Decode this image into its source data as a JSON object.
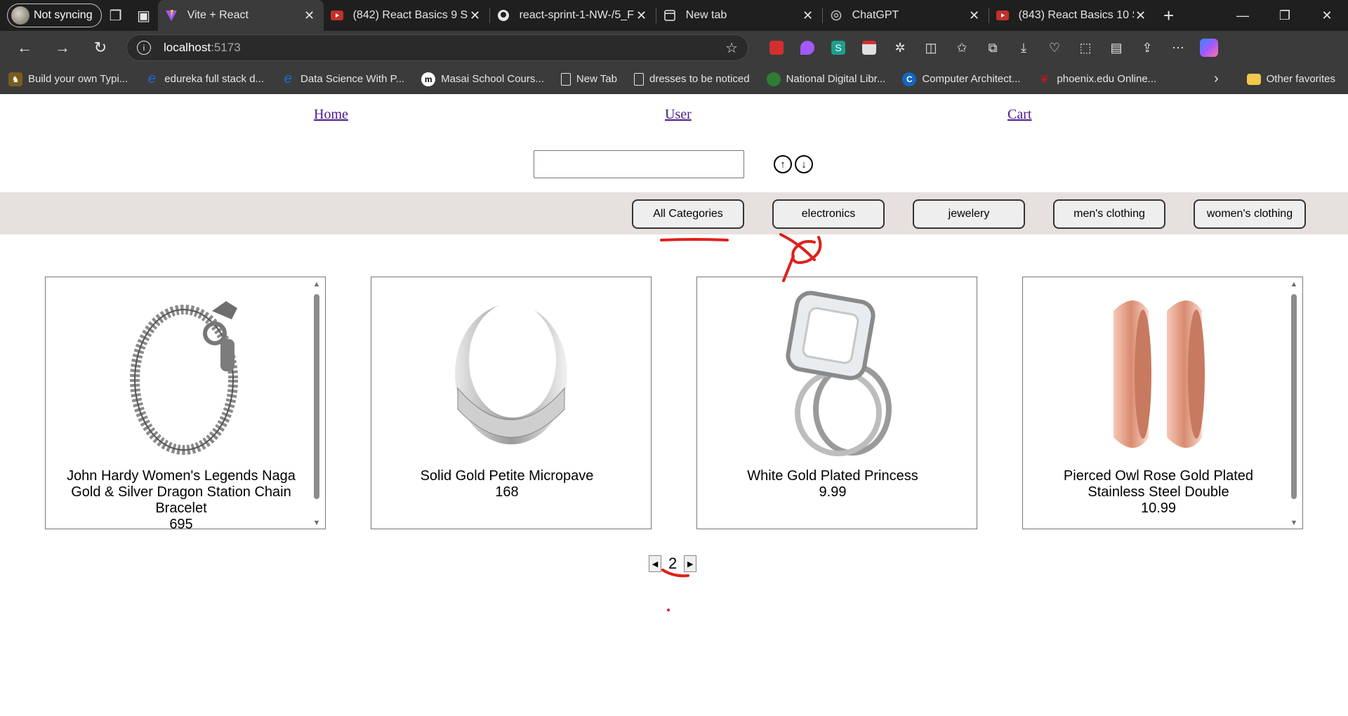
{
  "browser": {
    "profile_label": "Not syncing",
    "tabs": [
      {
        "title": "Vite + React",
        "favicon_color": "#a259ff",
        "active": true
      },
      {
        "title": "(842) React Basics 9 Spr",
        "favicon_color": "#ff0000",
        "active": false
      },
      {
        "title": "react-sprint-1-NW-/5_F",
        "favicon_color": "#ffffff",
        "active": false
      },
      {
        "title": "New tab",
        "favicon_color": "#cccccc",
        "active": false
      },
      {
        "title": "ChatGPT",
        "favicon_color": "#cccccc",
        "active": false
      },
      {
        "title": "(843) React Basics 10 Sp",
        "favicon_color": "#ff0000",
        "active": false
      }
    ],
    "url_host": "localhost",
    "url_port": ":5173",
    "bookmarks": [
      {
        "label": "Build your own Typi...",
        "color": "#7a5c1e"
      },
      {
        "label": "edureka full stack d...",
        "color": "#1a6fd1"
      },
      {
        "label": "Data Science With P...",
        "color": "#1a6fd1"
      },
      {
        "label": "Masai School Cours...",
        "color": "#ffffff"
      },
      {
        "label": "New Tab",
        "color": "#3b3b3b"
      },
      {
        "label": "dresses to be noticed",
        "color": "#3b3b3b"
      },
      {
        "label": "National Digital Libr...",
        "color": "#2e7d32"
      },
      {
        "label": "Computer Architect...",
        "color": "#1565c0"
      },
      {
        "label": "phoenix.edu Online...",
        "color": "#b71c1c"
      }
    ],
    "other_favorites": "Other favorites"
  },
  "nav": {
    "home": "Home",
    "user": "User",
    "cart": "Cart"
  },
  "search": {
    "value": "",
    "sort_up": "↑",
    "sort_down": "↓"
  },
  "categories": [
    "All Categories",
    "electronics",
    "jewelery",
    "men's clothing",
    "women's clothing"
  ],
  "products": [
    {
      "title": "John Hardy Women's Legends Naga Gold & Silver Dragon Station Chain Bracelet",
      "price": "695",
      "image": "bracelet-icon"
    },
    {
      "title": "Solid Gold Petite Micropave",
      "price": "168",
      "image": "ring-icon"
    },
    {
      "title": "White Gold Plated Princess",
      "price": "9.99",
      "image": "diamond-ring-icon"
    },
    {
      "title": "Pierced Owl Rose Gold Plated Stainless Steel Double",
      "price": "10.99",
      "image": "rose-gold-plugs-icon"
    }
  ],
  "pagination": {
    "page": "2"
  },
  "colors": {
    "category_bar": "#e6e0df",
    "link": "#4b1a8a",
    "annotation": "#e0201c"
  }
}
